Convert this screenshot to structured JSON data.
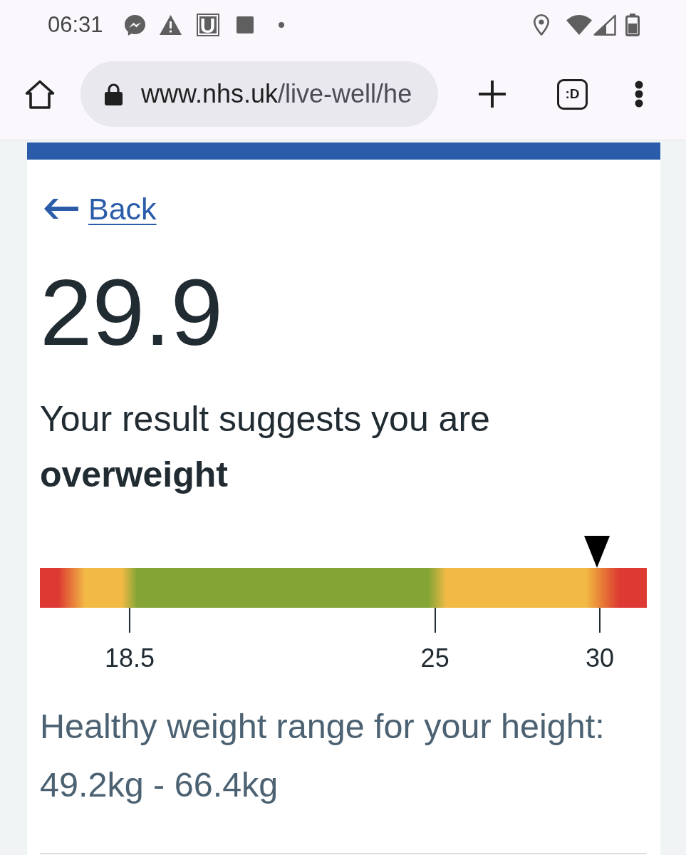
{
  "status_bar": {
    "time": "06:31",
    "notification_badge": "U"
  },
  "toolbar": {
    "address": {
      "host": "www.nhs.uk",
      "path": "/live-well/he"
    },
    "tab_switcher": ":D"
  },
  "back_link": {
    "label": "Back"
  },
  "result": {
    "bmi": "29.9",
    "message": "Your result suggests you are **overweight**"
  },
  "scale": {
    "level": 0.918,
    "ticks": [
      {
        "label": "18.5"
      },
      {
        "label": "25"
      },
      {
        "label": "30"
      }
    ]
  },
  "healthy_range": {
    "label": "Healthy weight range for your height:",
    "value": "49.2kg - 66.4kg"
  }
}
